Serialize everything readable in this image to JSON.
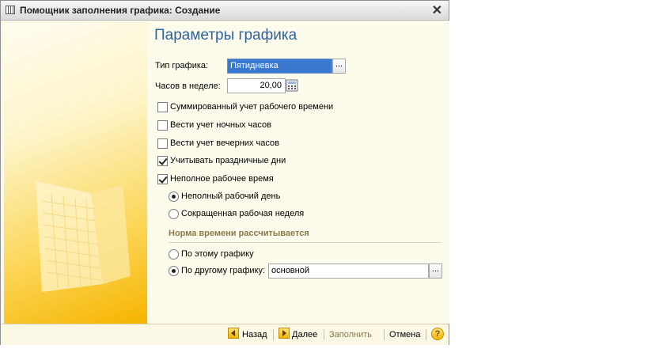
{
  "window": {
    "title": "Помощник заполнения графика: Создание"
  },
  "page": {
    "title": "Параметры графика"
  },
  "form": {
    "schedule_type_label": "Тип графика:",
    "schedule_type_value": "Пятидневка",
    "hours_label": "Часов в неделе:",
    "hours_value": "20,00"
  },
  "options": {
    "summed": {
      "label": "Суммированный учет рабочего времени",
      "checked": false
    },
    "night": {
      "label": "Вести учет ночных часов",
      "checked": false
    },
    "evening": {
      "label": "Вести учет вечерних часов",
      "checked": false
    },
    "holidays": {
      "label": "Учитывать праздничные дни",
      "checked": true
    },
    "parttime": {
      "label": "Неполное рабочее время",
      "checked": true
    },
    "partday": {
      "label": "Неполный рабочий день",
      "selected": true
    },
    "shortweek": {
      "label": "Сокращенная рабочая неделя",
      "selected": false
    }
  },
  "norm": {
    "heading": "Норма времени рассчитывается",
    "this_schedule": {
      "label": "По этому графику",
      "selected": false
    },
    "other_schedule": {
      "label": "По другому графику:",
      "selected": true,
      "value": "основной"
    }
  },
  "footer": {
    "back": "Назад",
    "next": "Далее",
    "fill": "Заполнить",
    "cancel": "Отмена",
    "help": "?"
  },
  "icons": {
    "app": "schedule-icon",
    "close": "close-icon",
    "select": "ellipsis-icon",
    "calculator": "calculator-icon",
    "back": "arrow-left-icon",
    "next": "arrow-right-icon",
    "help": "help-icon"
  },
  "colors": {
    "accent": "#2f62a0",
    "selection": "#3b78cf",
    "section": "#8a7a48",
    "button": "#f5b400"
  }
}
